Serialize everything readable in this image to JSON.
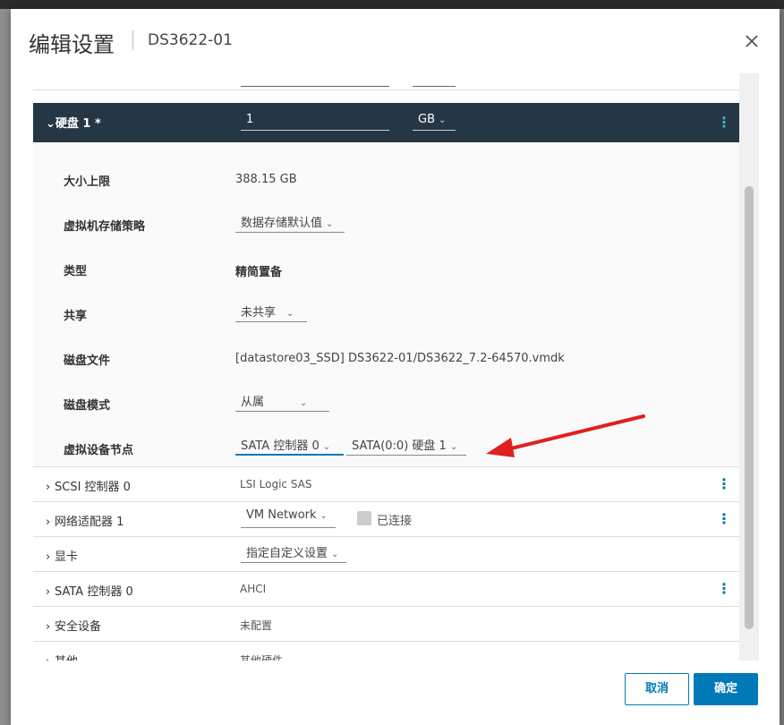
{
  "dialog": {
    "title": "编辑设置",
    "subtitle": "DS3622-01",
    "cancel_label": "取消",
    "ok_label": "确定"
  },
  "hard_disk": {
    "label": "硬盘 1 *",
    "size": "1",
    "unit": "GB",
    "props": {
      "max_size_label": "大小上限",
      "max_size_value": "388.15 GB",
      "policy_label": "虚拟机存储策略",
      "policy_value": "数据存储默认值",
      "type_label": "类型",
      "type_value": "精简置备",
      "sharing_label": "共享",
      "sharing_value": "未共享",
      "disk_file_label": "磁盘文件",
      "disk_file_value": "[datastore03_SSD] DS3622-01/DS3622_7.2-64570.vmdk",
      "disk_mode_label": "磁盘模式",
      "disk_mode_value": "从属",
      "vdn_label": "虚拟设备节点",
      "vdn_controller": "SATA 控制器 0",
      "vdn_slot": "SATA(0:0) 硬盘 1"
    }
  },
  "devices": [
    {
      "label": "SCSI 控制器 0",
      "value": "LSI Logic SAS"
    },
    {
      "label": "网络适配器 1",
      "value": "VM Network",
      "checkbox_label": "已连接"
    },
    {
      "label": "显卡",
      "value": "指定自定义设置"
    },
    {
      "label": "SATA 控制器 0",
      "value": "AHCI"
    },
    {
      "label": "安全设备",
      "value": "未配置"
    },
    {
      "label": "其他",
      "value": "其他硬件"
    }
  ],
  "colors": {
    "accent": "#0079b8",
    "disk_header_bg": "#253745",
    "annotation_arrow": "#e02020"
  },
  "icons": {
    "close": "close-icon",
    "chevron_down": "chevron-down-icon",
    "chevron_right": "chevron-right-icon",
    "kebab": "kebab-menu-icon"
  }
}
